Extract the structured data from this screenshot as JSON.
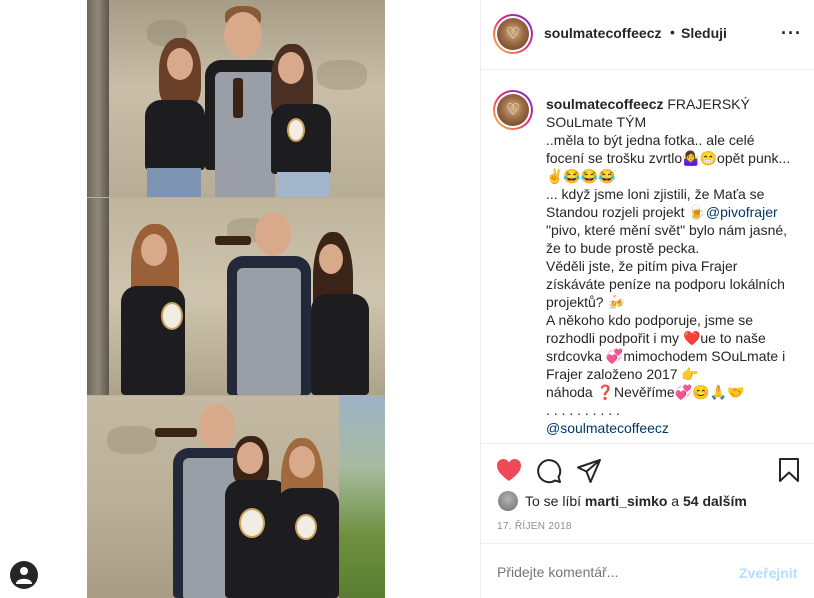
{
  "header": {
    "username": "soulmatecoffeecz",
    "separator": "•",
    "follow_label": "Sleduji",
    "more_icon": "more-horizontal-icon"
  },
  "caption": {
    "username": "soulmatecoffeecz",
    "lines": [
      "FRAJERSKÝ",
      "SOuLmate TÝM",
      "..měla to být jedna fotka.. ale celé",
      "focení se trošku zvrtlo🤷‍♀️😁opět punk...",
      "✌️😂😂😂",
      "... když jsme loni zjistili, že Maťa se",
      "Standou rozjeli projekt ",
      "\"pivo, které mění svět\" bylo nám jasné,",
      "že to bude prostě pecka.",
      "Věděli jste, že pitím piva Frajer",
      "získáváte peníze na podporu lokálních",
      "projektů? 🍻",
      "A někoho kdo podporuje, jsme se",
      "rozhodli podpořit i my ❤️ue to naše",
      "srdcovka 💞mimochodem SOuLmate i",
      "Frajer založeno 2017 👉",
      "náhoda ❓Nevěříme💞😊🙏🤝",
      ". . . . . . . . . ."
    ],
    "inline_emoji": "🍺",
    "inline_mention": "@pivofrajer",
    "closing_mention": "@soulmatecoffeecz"
  },
  "actions": {
    "like_icon": "heart-icon",
    "comment_icon": "comment-icon",
    "share_icon": "share-icon",
    "save_icon": "bookmark-icon",
    "like_color": "#ed4956"
  },
  "likes": {
    "prefix": "To se líbí",
    "user": "marti_simko",
    "connector": "a",
    "others": "54 dalším"
  },
  "post_date": "17. ŘÍJEN 2018",
  "comment": {
    "placeholder": "Přidejte komentář...",
    "post_label": "Zveřejnit"
  },
  "colors": {
    "text": "#262626",
    "muted": "#8e8e8e",
    "mention": "#00376b",
    "post_button_disabled": "#b2dffc"
  }
}
